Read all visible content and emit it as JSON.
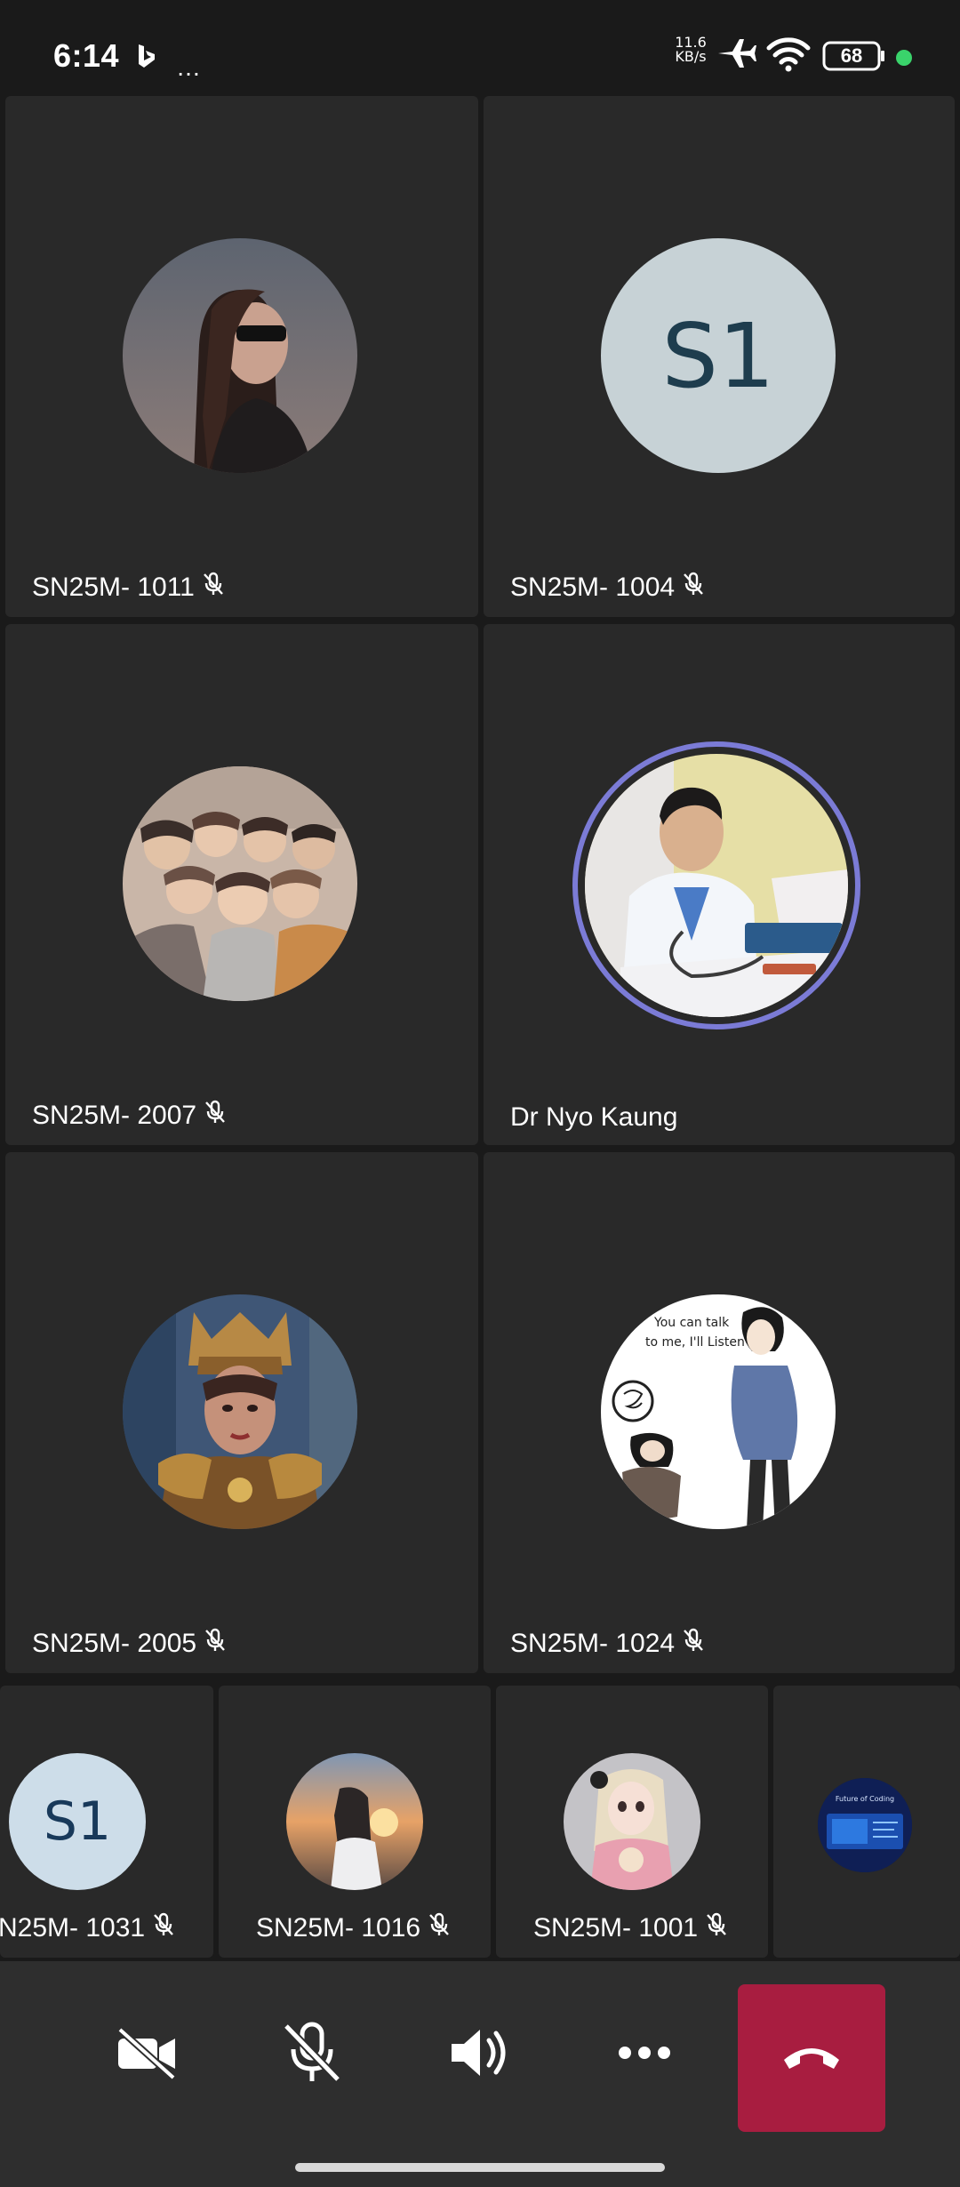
{
  "status_bar": {
    "time": "6:14",
    "overflow": "…",
    "net_speed_value": "11.6",
    "net_speed_unit": "KB/s",
    "battery": "68",
    "icons": [
      "bing-icon",
      "airplane-icon",
      "wifi-icon",
      "battery-icon"
    ]
  },
  "participants": [
    {
      "name": "SN25M- 1011",
      "muted": true,
      "avatar": "photo-woman-sunglasses"
    },
    {
      "name": "SN25M- 1004",
      "muted": true,
      "avatar": "initials",
      "initials": "S1"
    },
    {
      "name": "SN25M- 2007",
      "muted": true,
      "avatar": "photo-group"
    },
    {
      "name": "Dr Nyo Kaung",
      "muted": false,
      "speaking": true,
      "avatar": "photo-doctor"
    },
    {
      "name": "SN25M- 2005",
      "muted": true,
      "avatar": "photo-costume"
    },
    {
      "name": "SN25M- 1024",
      "muted": true,
      "avatar": "illustration-couple"
    }
  ],
  "strip": [
    {
      "name": "N25M- 1031",
      "muted": true,
      "avatar": "initials",
      "initials": "S1"
    },
    {
      "name": "SN25M- 1016",
      "muted": true,
      "avatar": "photo-sunset-girl"
    },
    {
      "name": "SN25M- 1001",
      "muted": true,
      "avatar": "photo-doll"
    },
    {
      "name": "",
      "muted": false,
      "avatar": "logo-future-of-coding",
      "logo_text": "Future of Coding"
    }
  ],
  "controls": [
    "camera-off-button",
    "mic-off-button",
    "speaker-button",
    "more-options-button",
    "end-call-button"
  ],
  "colors": {
    "background": "#1a1a1a",
    "tile": "#292929",
    "controls_bar": "#2e2e2e",
    "end_call": "#a81d40",
    "speaking_ring": "#7b7bd6",
    "initials_bg": "#c7d2d6"
  }
}
